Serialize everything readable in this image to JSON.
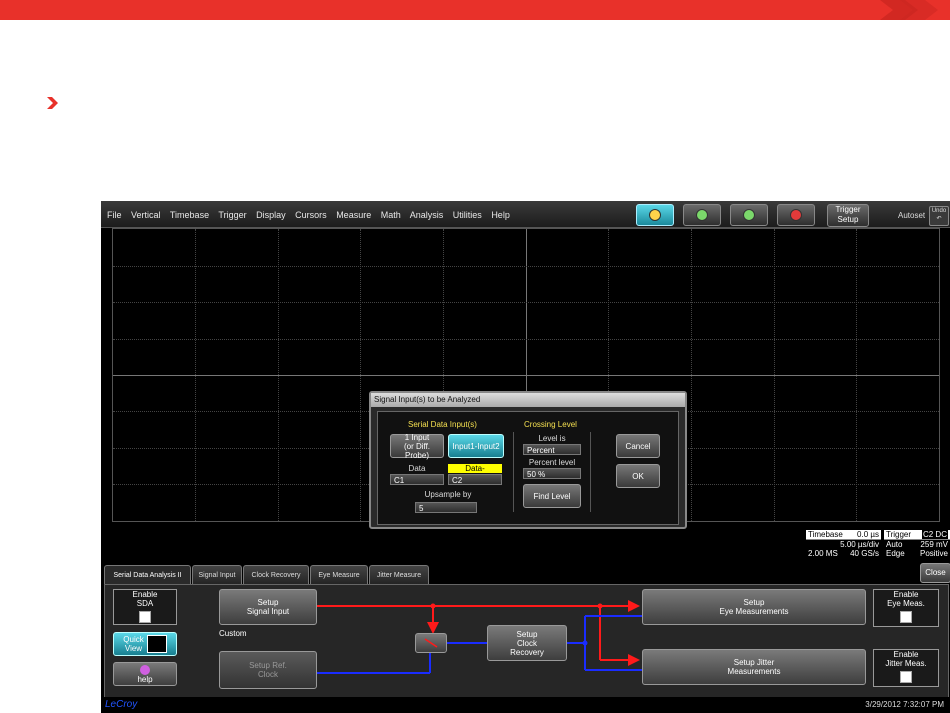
{
  "menu": {
    "items": [
      "File",
      "Vertical",
      "Timebase",
      "Trigger",
      "Display",
      "Cursors",
      "Measure",
      "Math",
      "Analysis",
      "Utilities",
      "Help"
    ],
    "trigger_setup_line1": "Trigger",
    "trigger_setup_line2": "Setup",
    "autoset": "Autoset",
    "undo_line1": "Undo",
    "undo_line2": "↶"
  },
  "dialog": {
    "title": "Signal Input(s) to be Analyzed",
    "serial_heading": "Serial Data Input(s)",
    "crossing_heading": "Crossing Level",
    "btn_1input_line1": "1 Input",
    "btn_1input_line2": "(or Diff. Probe)",
    "btn_input12": "Input1-Input2",
    "data_label": "Data",
    "data_value": "C1",
    "datam_label": "Data-",
    "datam_value": "C2",
    "upsample_label": "Upsample by",
    "upsample_value": "5",
    "level_is_label": "Level is",
    "level_is_value": "Percent",
    "percent_level_label": "Percent level",
    "percent_level_value": "50 %",
    "find_level": "Find Level",
    "cancel": "Cancel",
    "ok": "OK"
  },
  "timebase": {
    "label": "Timebase",
    "value": "0.0 µs",
    "div": "5.00 µs/div",
    "ms": "2.00 MS",
    "rate": "40 GS/s"
  },
  "trigger": {
    "label": "Trigger",
    "ch": "C2 DC",
    "mode": "Auto",
    "level": "259 mV",
    "type": "Edge",
    "slope": "Positive"
  },
  "tabs": [
    "Serial Data Analysis II",
    "Signal Input",
    "Clock Recovery",
    "Eye Measure",
    "Jitter Measure"
  ],
  "close": "Close",
  "panel": {
    "enable_sda_line1": "Enable",
    "enable_sda_line2": "SDA",
    "quick_view_line1": "Quick",
    "quick_view_line2": "View",
    "help": "help",
    "setup_signal_line1": "Setup",
    "setup_signal_line2": "Signal Input",
    "custom": "Custom",
    "setup_ref_line1": "Setup Ref.",
    "setup_ref_line2": "Clock",
    "setup_clock_line1": "Setup",
    "setup_clock_line2": "Clock",
    "setup_clock_line3": "Recovery",
    "setup_eye_line1": "Setup",
    "setup_eye_line2": "Eye Measurements",
    "setup_jitter_line1": "Setup Jitter",
    "setup_jitter_line2": "Measurements",
    "enable_eye_line1": "Enable",
    "enable_eye_line2": "Eye Meas.",
    "enable_jitter_line1": "Enable",
    "enable_jitter_line2": "Jitter Meas."
  },
  "status": {
    "brand": "LeCroy",
    "datetime": "3/29/2012 7:32:07 PM"
  },
  "colors": {
    "accent_red": "#e8312a",
    "signal_red": "#ff1a1a",
    "clock_blue": "#1a2cff",
    "active_cyan": "#3ab8cc"
  }
}
